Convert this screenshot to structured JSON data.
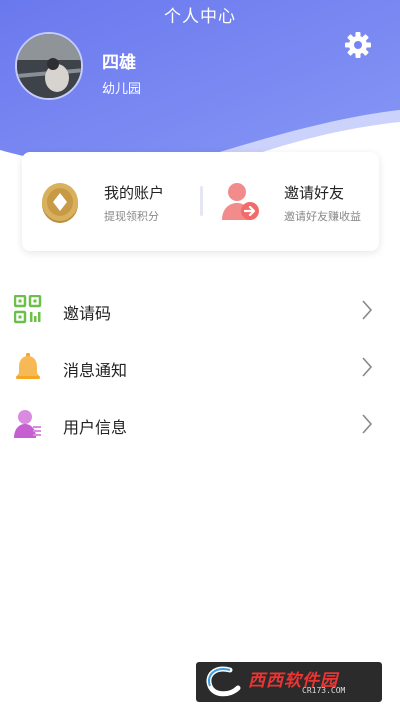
{
  "header": {
    "title": "个人中心",
    "user_name": "四雄",
    "user_sub": "幼儿园",
    "gradient_start": "#6b7bf0",
    "gradient_end": "#8a9af6"
  },
  "card": {
    "account": {
      "title": "我的账户",
      "sub": "提现领积分",
      "icon": "coin-icon"
    },
    "invite": {
      "title": "邀请好友",
      "sub": "邀请好友赚收益",
      "icon": "invite-user-icon"
    }
  },
  "menu": {
    "items": [
      {
        "label": "邀请码",
        "icon": "qr-code-icon"
      },
      {
        "label": "消息通知",
        "icon": "bell-icon"
      },
      {
        "label": "用户信息",
        "icon": "user-info-icon"
      }
    ]
  },
  "watermark": {
    "text": "西西软件园",
    "domain": "CR173.COM"
  }
}
